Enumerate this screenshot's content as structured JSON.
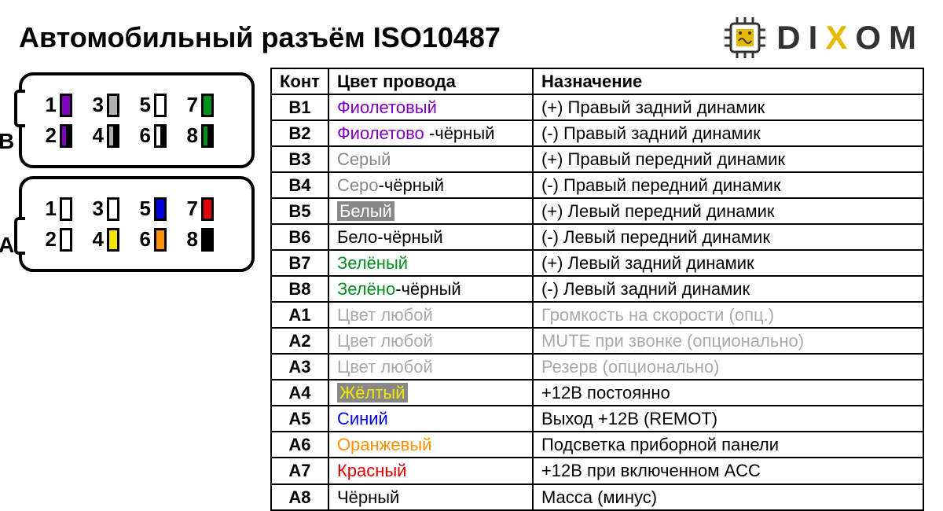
{
  "title": "Автомобильный разъём ISO10487",
  "brand": {
    "d": "D",
    "i": "I",
    "x": "X",
    "o": "O",
    "m": "M"
  },
  "headers": {
    "pin": "Конт",
    "color": "Цвет провода",
    "func": "Назначение"
  },
  "connector": {
    "B": {
      "row1": [
        {
          "n": "1",
          "bg": "#8000c0",
          "stripe": false
        },
        {
          "n": "3",
          "bg": "#b0b0b0",
          "stripe": false
        },
        {
          "n": "5",
          "bg": "#ffffff",
          "stripe": false
        },
        {
          "n": "7",
          "bg": "#009020",
          "stripe": false
        }
      ],
      "row2": [
        {
          "n": "2",
          "bg": "#8000c0",
          "stripe": true
        },
        {
          "n": "4",
          "bg": "#b0b0b0",
          "stripe": true
        },
        {
          "n": "6",
          "bg": "#ffffff",
          "stripe": true
        },
        {
          "n": "8",
          "bg": "#009020",
          "stripe": true
        }
      ]
    },
    "A": {
      "row1": [
        {
          "n": "1",
          "bg": "#ffffff",
          "stripe": false
        },
        {
          "n": "3",
          "bg": "#ffffff",
          "stripe": false
        },
        {
          "n": "5",
          "bg": "#0000e0",
          "stripe": false
        },
        {
          "n": "7",
          "bg": "#e00000",
          "stripe": false
        }
      ],
      "row2": [
        {
          "n": "2",
          "bg": "#ffffff",
          "stripe": false
        },
        {
          "n": "4",
          "bg": "#f5e800",
          "stripe": false
        },
        {
          "n": "6",
          "bg": "#ff9000",
          "stripe": false
        },
        {
          "n": "8",
          "bg": "#000000",
          "stripe": false
        }
      ]
    }
  },
  "rows": [
    {
      "pin": "B1",
      "color_html": "<span style='color:#8000c0'>Фиолетовый</span>",
      "func": "(+) Правый задний динамик",
      "muted": false
    },
    {
      "pin": "B2",
      "color_html": "<span style='color:#8000c0'>Фиолетово</span> -чёрный",
      "func": "(-)  Правый задний динамик",
      "muted": false
    },
    {
      "pin": "B3",
      "color_html": "<span style='color:#888'>Серый</span>",
      "func": "(+) Правый передний динамик",
      "muted": false
    },
    {
      "pin": "B4",
      "color_html": "<span style='color:#888'>Серо</span>-чёрный",
      "func": "(-)  Правый передний динамик",
      "muted": false
    },
    {
      "pin": "B5",
      "color_html": "<span class='hl-grey'>Белый</span>",
      "func": "(+) Левый передний динамик",
      "muted": false
    },
    {
      "pin": "B6",
      "color_html": "Бело-чёрный",
      "func": "(-)  Левый передний динамик",
      "muted": false
    },
    {
      "pin": "B7",
      "color_html": "<span style='color:#009020'>Зелёный</span>",
      "func": "(+) Левый задний динамик",
      "muted": false
    },
    {
      "pin": "B8",
      "color_html": "<span style='color:#009020'>Зелёно</span>-чёрный",
      "func": "(-)  Левый задний динамик",
      "muted": false
    },
    {
      "pin": "A1",
      "color_html": "Цвет любой",
      "func": "Громкость на скорости (опц.)",
      "muted": true
    },
    {
      "pin": "A2",
      "color_html": "Цвет любой",
      "func": "MUTE при звонке (опционально)",
      "muted": true
    },
    {
      "pin": "A3",
      "color_html": "Цвет любой",
      "func": "Резерв (опционально)",
      "muted": true
    },
    {
      "pin": "A4",
      "color_html": "<span class='hl-y' style='color:#f5e800'>Жёлтый</span>",
      "func": "+12В постоянно",
      "muted": false
    },
    {
      "pin": "A5",
      "color_html": "<span style='color:#0000e0'>Синий</span>",
      "func": "Выход +12В (REMOT)",
      "muted": false
    },
    {
      "pin": "A6",
      "color_html": "<span style='color:#ff9000'>Оранжевый</span>",
      "func": "Подсветка приборной панели",
      "muted": false
    },
    {
      "pin": "A7",
      "color_html": "<span style='color:#e00000'>Красный</span>",
      "func": "+12В при включенном ACC",
      "muted": false
    },
    {
      "pin": "A8",
      "color_html": "Чёрный",
      "func": "Масса (минус)",
      "muted": false
    }
  ]
}
